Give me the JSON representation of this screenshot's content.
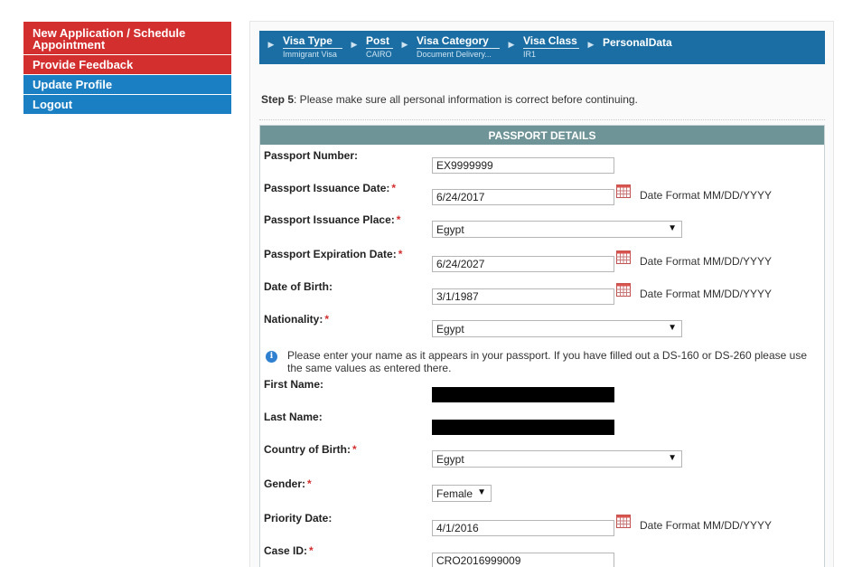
{
  "sidenav": {
    "items": [
      {
        "label": "New Application / Schedule Appointment",
        "color": "#d32f2f"
      },
      {
        "label": "Provide Feedback",
        "color": "#d32f2f"
      },
      {
        "label": "Update Profile",
        "color": "#1b7fc3"
      },
      {
        "label": "Logout",
        "color": "#1b7fc3"
      }
    ]
  },
  "breadcrumb": {
    "steps": [
      {
        "title": "Visa Type",
        "value": "Immigrant Visa"
      },
      {
        "title": "Post",
        "value": "CAIRO"
      },
      {
        "title": "Visa Category",
        "value": "Document Delivery..."
      },
      {
        "title": "Visa Class",
        "value": "IR1"
      },
      {
        "title": "PersonalData",
        "value": ""
      }
    ]
  },
  "step": {
    "label": "Step 5",
    "text": ": Please make sure all personal information is correct before continuing."
  },
  "passport": {
    "header": "PASSPORT DETAILS",
    "date_format": "Date Format MM/DD/YYYY",
    "fields": {
      "passport_number": {
        "label": "Passport Number:",
        "value": "EX9999999",
        "required": false
      },
      "issuance_date": {
        "label": "Passport Issuance Date:",
        "value": "6/24/2017",
        "required": true
      },
      "issuance_place": {
        "label": "Passport Issuance Place:",
        "value": "Egypt",
        "required": true
      },
      "expiration_date": {
        "label": "Passport Expiration Date:",
        "value": "6/24/2027",
        "required": true
      },
      "date_of_birth": {
        "label": "Date of Birth:",
        "value": "3/1/1987",
        "required": false
      },
      "nationality": {
        "label": "Nationality:",
        "value": "Egypt",
        "required": true
      },
      "first_name": {
        "label": "First Name:",
        "value": "",
        "required": false
      },
      "last_name": {
        "label": "Last Name:",
        "value": "",
        "required": false
      },
      "country_of_birth": {
        "label": "Country of Birth:",
        "value": "Egypt",
        "required": true
      },
      "gender": {
        "label": "Gender:",
        "value": "Female",
        "required": true
      },
      "priority_date": {
        "label": "Priority Date:",
        "value": "4/1/2016",
        "required": false
      },
      "case_id": {
        "label": "Case ID:",
        "value": "CRO2016999009",
        "required": true
      }
    },
    "name_note": "Please enter your name as it appears in your passport. If you have filled out a DS-160 or DS-260 please use the same values as entered there."
  },
  "required_marker": "*",
  "icons": {
    "info": "info-icon",
    "calendar": "calendar-icon",
    "dropdown": "chevron-down-icon",
    "crumb_arrow": "chevron-right-icon"
  }
}
